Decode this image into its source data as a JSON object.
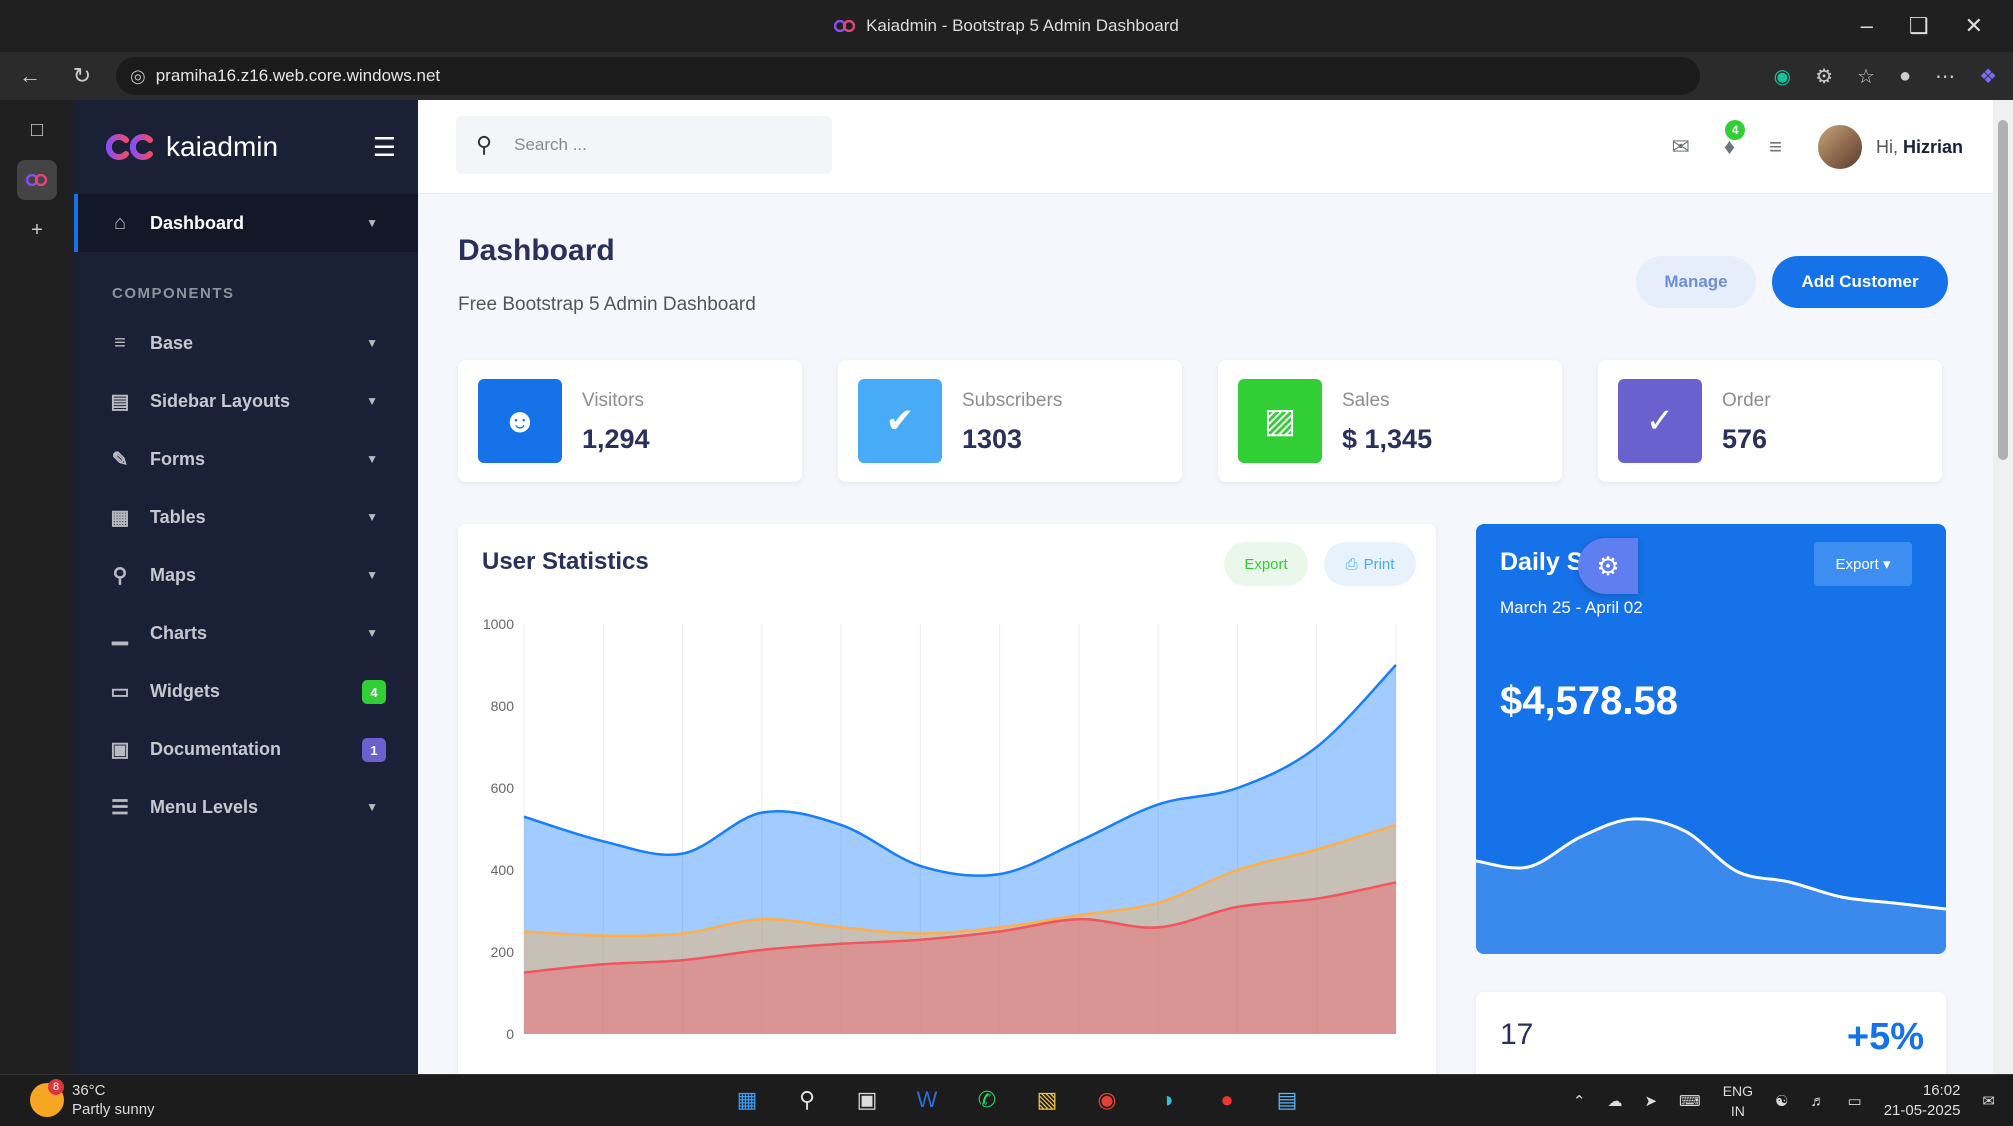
{
  "window": {
    "title": "Kaiadmin - Bootstrap 5 Admin Dashboard"
  },
  "browser": {
    "url": "pramiha16.z16.web.core.windows.net"
  },
  "sidebar": {
    "brand": "kaiadmin",
    "section_label": "COMPONENTS",
    "items": [
      {
        "label": "Dashboard",
        "icon": "home-icon"
      },
      {
        "label": "Base",
        "icon": "layers-icon"
      },
      {
        "label": "Sidebar Layouts",
        "icon": "th-list-icon"
      },
      {
        "label": "Forms",
        "icon": "pen-square-icon"
      },
      {
        "label": "Tables",
        "icon": "table-icon"
      },
      {
        "label": "Maps",
        "icon": "map-marker-icon"
      },
      {
        "label": "Charts",
        "icon": "chart-bar-icon"
      },
      {
        "label": "Widgets",
        "icon": "desktop-icon",
        "badge": "4"
      },
      {
        "label": "Documentation",
        "icon": "file-icon",
        "badge": "1"
      },
      {
        "label": "Menu Levels",
        "icon": "bars-icon"
      }
    ]
  },
  "topbar": {
    "search_placeholder": "Search ...",
    "notification_count": "4",
    "greeting": "Hi,",
    "username": "Hizrian"
  },
  "page": {
    "title": "Dashboard",
    "subtitle": "Free Bootstrap 5 Admin Dashboard",
    "manage_label": "Manage",
    "add_customer_label": "Add Customer"
  },
  "stats": [
    {
      "label": "Visitors",
      "value": "1,294",
      "color": "#1572e8",
      "icon": "users-icon"
    },
    {
      "label": "Subscribers",
      "value": "1303",
      "color": "#48abf7",
      "icon": "user-check-icon"
    },
    {
      "label": "Sales",
      "value": "$ 1,345",
      "color": "#31ce36",
      "icon": "luggage-cart-icon"
    },
    {
      "label": "Order",
      "value": "576",
      "color": "#6861ce",
      "icon": "check-circle-icon"
    }
  ],
  "user_statistics": {
    "title": "User Statistics",
    "export_label": "Export",
    "print_label": "Print"
  },
  "chart_data": {
    "type": "area",
    "title": "",
    "xlabel": "",
    "ylabel": "",
    "ylim": [
      0,
      1000
    ],
    "yticks": [
      "0",
      "200",
      "400",
      "600",
      "800",
      "1000"
    ],
    "x": [
      0,
      1,
      2,
      3,
      4,
      5,
      6,
      7,
      8,
      9,
      10,
      11
    ],
    "series": [
      {
        "color": "#f3545d",
        "values": [
          150,
          170,
          180,
          205,
          220,
          230,
          250,
          280,
          260,
          310,
          330,
          370
        ]
      },
      {
        "color": "#fdaf4b",
        "values": [
          250,
          240,
          245,
          280,
          260,
          245,
          260,
          290,
          320,
          400,
          450,
          510
        ]
      },
      {
        "color": "#177dff",
        "values": [
          530,
          470,
          440,
          540,
          510,
          410,
          390,
          470,
          560,
          600,
          700,
          900
        ]
      }
    ],
    "grid": true
  },
  "daily_sales": {
    "title": "Daily Sales",
    "date_range": "March 25 - April 02",
    "amount": "$4,578.58",
    "export_label": "Export",
    "trend": [
      0.42,
      0.38,
      0.58,
      0.7,
      0.62,
      0.35,
      0.28,
      0.18,
      0.14,
      0.1
    ]
  },
  "bottom_card": {
    "number": "17",
    "percent": "+5%"
  },
  "taskbar": {
    "temperature": "36°C",
    "weather": "Partly sunny",
    "weather_badge": "8",
    "language": "ENG",
    "region": "IN",
    "time": "16:02",
    "date": "21-05-2025"
  }
}
